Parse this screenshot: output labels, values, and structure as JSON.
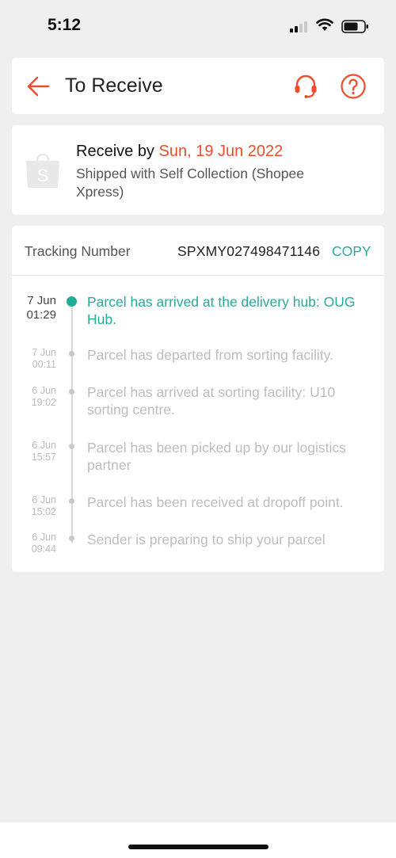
{
  "status_bar": {
    "time": "5:12"
  },
  "header": {
    "title": "To Receive"
  },
  "shipping": {
    "receive_prefix": "Receive by",
    "receive_date": "Sun, 19 Jun 2022",
    "method": "Shipped with Self Collection (Shopee Xpress)"
  },
  "tracking": {
    "label": "Tracking Number",
    "number": "SPXMY027498471146",
    "copy_label": "COPY",
    "events": [
      {
        "date": "7 Jun",
        "time": "01:29",
        "description": "Parcel has arrived at the delivery hub: OUG Hub."
      },
      {
        "date": "7 Jun",
        "time": "00:11",
        "description": "Parcel has departed from sorting facility."
      },
      {
        "date": "6 Jun",
        "time": "19:02",
        "description": "Parcel has arrived at sorting facility: U10 sorting centre."
      },
      {
        "date": "6 Jun",
        "time": "15:57",
        "description": "Parcel has been picked up by our logistics partner"
      },
      {
        "date": "6 Jun",
        "time": "15:02",
        "description": "Parcel has been received at dropoff point."
      },
      {
        "date": "6 Jun",
        "time": "09:44",
        "description": "Sender is preparing to ship your parcel"
      }
    ]
  },
  "colors": {
    "accent": "#ee4d2d",
    "teal": "#26aa99",
    "background": "#efefef"
  },
  "icons": [
    "back-arrow-icon",
    "headset-icon",
    "help-icon",
    "shop-bag-icon",
    "signal-icon",
    "wifi-icon",
    "battery-icon"
  ]
}
